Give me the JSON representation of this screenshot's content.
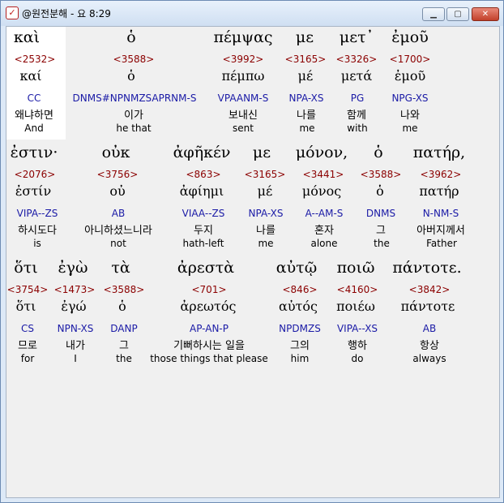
{
  "window": {
    "title": "@원전분해 - 요 8:29",
    "min_label": "▁",
    "max_label": "▢",
    "close_label": "✕",
    "icon_glyph": "✓"
  },
  "lines": [
    {
      "words": [
        {
          "greek": "καὶ",
          "num": "<2532>",
          "lemma": "καί",
          "tag": "CC",
          "kor": "왜냐하면",
          "eng": "And"
        },
        {
          "greek": "ὁ",
          "num": "<3588>",
          "lemma": "ὁ",
          "tag": "DNMS#NPNMZSAPRNM-S",
          "kor": "이가",
          "eng": "he that"
        },
        {
          "greek": "πέμψας",
          "num": "<3992>",
          "lemma": "πέμπω",
          "tag": "VPAANM-S",
          "kor": "보내신",
          "eng": "sent"
        },
        {
          "greek": "με",
          "num": "<3165>",
          "lemma": "μέ",
          "tag": "NPA-XS",
          "kor": "나를",
          "eng": "me"
        },
        {
          "greek": "μετ᾽",
          "num": "<3326>",
          "lemma": "μετά",
          "tag": "PG",
          "kor": "함께",
          "eng": "with"
        },
        {
          "greek": "ἐμοῦ",
          "num": "<1700>",
          "lemma": "ἐμοῦ",
          "tag": "NPG-XS",
          "kor": "나와",
          "eng": "me"
        }
      ]
    },
    {
      "words": [
        {
          "greek": "ἐστιν·",
          "num": "<2076>",
          "lemma": "ἐστίν",
          "tag": "VIPA--ZS",
          "kor": "하시도다",
          "eng": "is"
        },
        {
          "greek": "οὐκ",
          "num": "<3756>",
          "lemma": "οὐ",
          "tag": "AB",
          "kor": "아니하셨느니라",
          "eng": "not"
        },
        {
          "greek": "ἀφῆκέν",
          "num": "<863>",
          "lemma": "ἀφίημι",
          "tag": "VIAA--ZS",
          "kor": "두지",
          "eng": "hath-left"
        },
        {
          "greek": "με",
          "num": "<3165>",
          "lemma": "μέ",
          "tag": "NPA-XS",
          "kor": "나를",
          "eng": "me"
        },
        {
          "greek": "μόνον,",
          "num": "<3441>",
          "lemma": "μόνος",
          "tag": "A--AM-S",
          "kor": "혼자",
          "eng": "alone"
        },
        {
          "greek": "ὁ",
          "num": "<3588>",
          "lemma": "ὁ",
          "tag": "DNMS",
          "kor": "그",
          "eng": "the"
        },
        {
          "greek": "πατήρ,",
          "num": "<3962>",
          "lemma": "πατήρ",
          "tag": "N-NM-S",
          "kor": "아버지께서",
          "eng": "Father"
        }
      ]
    },
    {
      "words": [
        {
          "greek": "ὅτι",
          "num": "<3754>",
          "lemma": "ὅτι",
          "tag": "CS",
          "kor": "므로",
          "eng": "for"
        },
        {
          "greek": "ἐγὼ",
          "num": "<1473>",
          "lemma": "ἐγώ",
          "tag": "NPN-XS",
          "kor": "내가",
          "eng": "I"
        },
        {
          "greek": "τὰ",
          "num": "<3588>",
          "lemma": "ὁ",
          "tag": "DANP",
          "kor": "그",
          "eng": "the"
        },
        {
          "greek": "ἀρεστὰ",
          "num": "<701>",
          "lemma": "ἀρεωτός",
          "tag": "AP-AN-P",
          "kor": "기뻐하시는 일을",
          "eng": "those things that please"
        },
        {
          "greek": "αὐτῷ",
          "num": "<846>",
          "lemma": "αὐτός",
          "tag": "NPDMZS",
          "kor": "그의",
          "eng": "him"
        },
        {
          "greek": "ποιῶ",
          "num": "<4160>",
          "lemma": "ποιέω",
          "tag": "VIPA--XS",
          "kor": "행하",
          "eng": "do"
        },
        {
          "greek": "πάντοτε.",
          "num": "<3842>",
          "lemma": "πάντοτε",
          "tag": "AB",
          "kor": "항상",
          "eng": "always"
        }
      ]
    }
  ]
}
